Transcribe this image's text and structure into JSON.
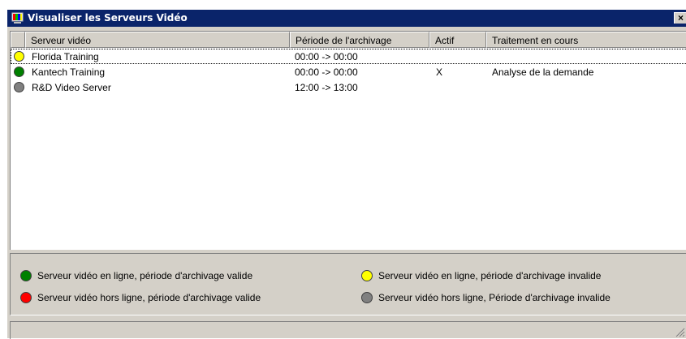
{
  "window": {
    "title": "Visualiser les Serveurs Vidéo",
    "close_label": "×"
  },
  "list": {
    "columns": [
      {
        "label": ""
      },
      {
        "label": "Serveur vidéo"
      },
      {
        "label": "Période de l'archivage"
      },
      {
        "label": "Actif"
      },
      {
        "label": "Traitement en cours"
      }
    ],
    "rows": [
      {
        "status_color": "#ffff00",
        "server": "Florida Training",
        "period": "00:00 -> 00:00",
        "active": "",
        "processing": ""
      },
      {
        "status_color": "#008000",
        "server": "Kantech Training",
        "period": "00:00 -> 00:00",
        "active": "X",
        "processing": "Analyse de la demande"
      },
      {
        "status_color": "#808080",
        "server": "R&D Video Server",
        "period": "12:00 -> 13:00",
        "active": "",
        "processing": ""
      }
    ]
  },
  "legend": {
    "items": [
      {
        "color": "#008000",
        "text": "Serveur vidéo en ligne, période d'archivage valide"
      },
      {
        "color": "#ffff00",
        "text": "Serveur vidéo en ligne, période d'archivage invalide"
      },
      {
        "color": "#ff0000",
        "text": "Serveur vidéo hors ligne, période d'archivage valide"
      },
      {
        "color": "#808080",
        "text": "Serveur vidéo hors ligne, Période d'archivage invalide"
      }
    ]
  },
  "colors": {
    "titlebar": "#0a246a",
    "face": "#d4d0c8",
    "list_background": "#ffffff"
  }
}
